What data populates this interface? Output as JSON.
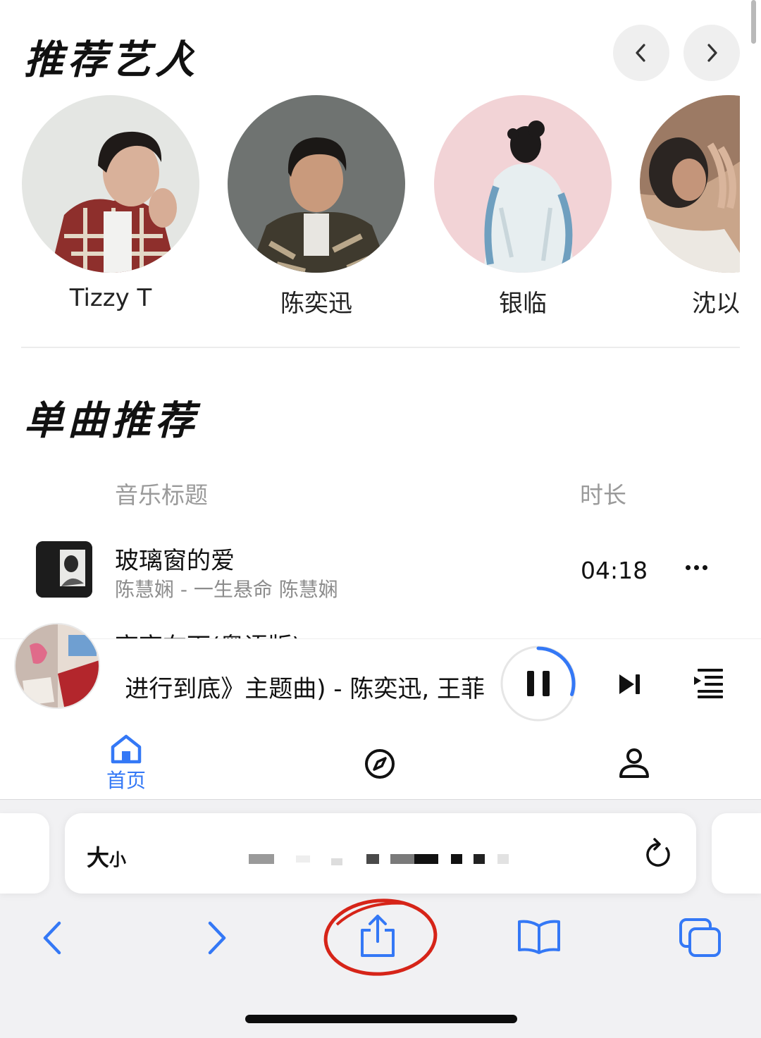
{
  "artists_section": {
    "title": "推荐艺人",
    "artists": [
      {
        "name": "Tizzy T"
      },
      {
        "name": "陈奕迅"
      },
      {
        "name": "银临"
      },
      {
        "name": "沈以"
      }
    ]
  },
  "songs_section": {
    "title": "单曲推荐",
    "columns": {
      "title": "音乐标题",
      "duration": "时长"
    },
    "songs": [
      {
        "title": "玻璃窗的爱",
        "subtitle": "陈慧娴 - 一生悬命 陈慧娴",
        "duration": "04:18"
      },
      {
        "title": "高高在下(粤语版)"
      }
    ]
  },
  "player": {
    "now_playing": "进行到底》主题曲) - 陈奕迅, 王菲",
    "progress_fraction": 0.3
  },
  "tabbar": {
    "home_label": "首页"
  },
  "safari": {
    "text_size_big": "大",
    "text_size_small": "小"
  },
  "colors": {
    "accent": "#3478f6",
    "annotation": "#d62418"
  }
}
